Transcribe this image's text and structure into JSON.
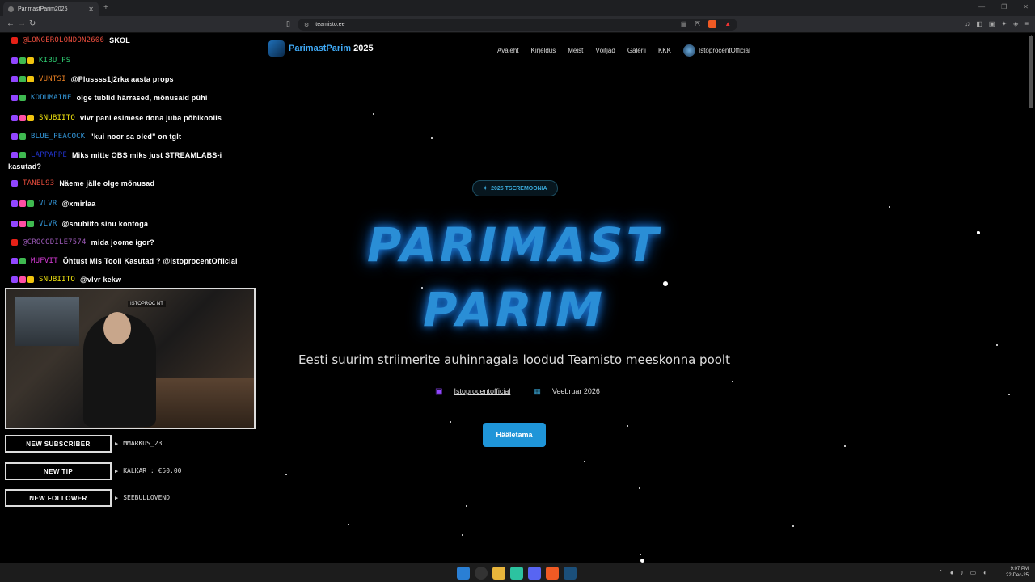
{
  "browser": {
    "tab_title": "ParimastParim2025",
    "url": "teamisto.ee"
  },
  "chat": [
    {
      "badges": [
        "b-yt"
      ],
      "user": "@LONGEROLONDON2606",
      "user_color": "#e74c3c",
      "text": "SKOL"
    },
    {
      "badges": [
        "b-tw",
        "b-gr",
        "b-yl"
      ],
      "user": "KIBU_PS",
      "user_color": "#2ecc71",
      "text": ""
    },
    {
      "badges": [
        "b-tw",
        "b-gr",
        "b-yl"
      ],
      "user": "VUNTSI",
      "user_color": "#e67e22",
      "text": "@Plussss1j2rka aasta props"
    },
    {
      "badges": [
        "b-tw",
        "b-gr"
      ],
      "user": "KODUMAINE",
      "user_color": "#3498db",
      "text": "olge tublid härrased, mõnusaid pühi"
    },
    {
      "badges": [
        "b-tw",
        "b-pk",
        "b-yl"
      ],
      "user": "SNUBIITO",
      "user_color": "#f1e40f",
      "text": "vlvr pani esimese dona juba põhikoolis"
    },
    {
      "badges": [
        "b-tw",
        "b-gr"
      ],
      "user": "BLUE_PEACOCK",
      "user_color": "#3498db",
      "text": "\"kui noor sa oled\" on tglt"
    },
    {
      "badges": [
        "b-tw",
        "b-gr"
      ],
      "user": "LAPPAPPE",
      "user_color": "#2233cc",
      "text": "Miks mitte OBS miks just STREAMLABS-i"
    },
    {
      "badges": [
        "b-tw"
      ],
      "user": "TANEL93",
      "user_color": "#e74c3c",
      "text": "Näeme jälle olge mõnusad"
    },
    {
      "badges": [
        "b-tw",
        "b-pk",
        "b-gr"
      ],
      "user": "VLVR",
      "user_color": "#3498db",
      "text": "@xmirlaa"
    },
    {
      "badges": [
        "b-tw",
        "b-pk",
        "b-gr"
      ],
      "user": "VLVR",
      "user_color": "#3498db",
      "text": "@snubiito  sinu kontoga"
    },
    {
      "badges": [
        "b-yt"
      ],
      "user": "@CROCODILE7574",
      "user_color": "#9b59b6",
      "text": "mida joome igor?"
    },
    {
      "badges": [
        "b-tw",
        "b-gr"
      ],
      "user": "MUFVIT",
      "user_color": "#d63bd6",
      "text": "Õhtust Mis Tooli Kasutad ? @IstoprocentOfficial"
    },
    {
      "badges": [
        "b-tw",
        "b-pk",
        "b-yl"
      ],
      "user": "SNUBIITO",
      "user_color": "#f1e40f",
      "text": "@vlvr kekw"
    }
  ],
  "chat_wrap": "kasutad?",
  "webcam_label": "ISTOPROC  NT",
  "alerts": [
    {
      "label": "NEW SUBSCRIBER",
      "value": "MMARKUS_23"
    },
    {
      "label": "NEW TIP",
      "value": "KALKAR_: €50.00"
    },
    {
      "label": "NEW FOLLOWER",
      "value": "SEEBULLOVEND"
    }
  ],
  "site": {
    "logo_a": "ParimastParim",
    "logo_b": " 2025",
    "nav": [
      "Avaleht",
      "Kirjeldus",
      "Meist",
      "Võitjad",
      "Galerii",
      "KKK"
    ],
    "nav_user": "IstoprocentOfficial",
    "pill": "2025 TSEREMOONIA",
    "hero_line1": "PARIMAST",
    "hero_line2": "PARIM",
    "tagline": "Eesti suurim striimerite auhinnagala loodud Teamisto meeskonna poolt",
    "host": "Istoprocentofficial",
    "date": "Veebruar 2026",
    "cta": "Hääletama"
  },
  "clock": {
    "time": "9:07 PM",
    "date": "22-Dec-25"
  },
  "colors": {
    "accent": "#1f95d8",
    "hero": "#2a8ed6",
    "twitch": "#9146ff"
  }
}
